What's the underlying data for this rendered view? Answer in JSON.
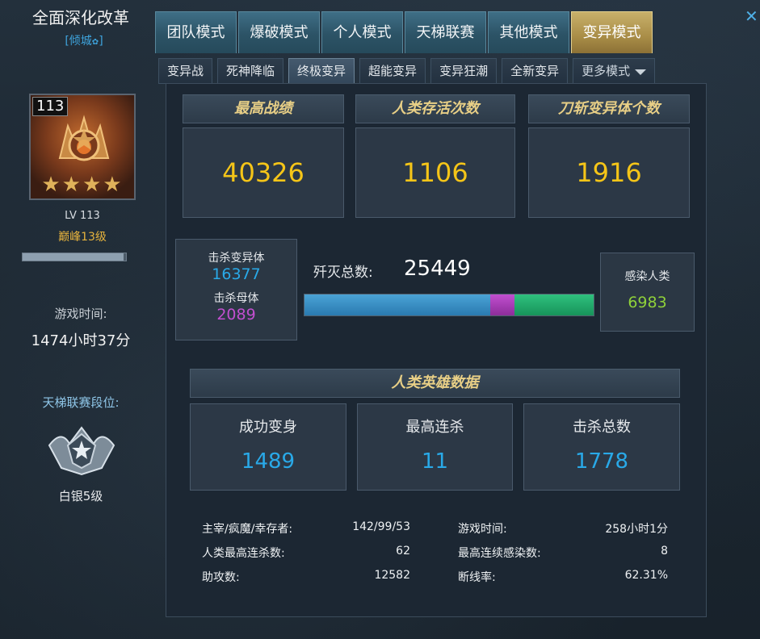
{
  "player": {
    "name": "全面深化改革",
    "clan": "[倾城",
    "clan_suffix": "]",
    "level_badge": "113",
    "level_text": "LV 113",
    "rank_title": "巅峰13级",
    "stars": "★★★★",
    "exp_fraction": 0.98,
    "game_time_label": "游戏时间:",
    "game_time_value": "1474小时37分",
    "ladder_label": "天梯联赛段位:",
    "ladder_rank": "白银5级"
  },
  "tabs": [
    {
      "label": "团队模式"
    },
    {
      "label": "爆破模式"
    },
    {
      "label": "个人模式"
    },
    {
      "label": "天梯联赛"
    },
    {
      "label": "其他模式"
    },
    {
      "label": "变异模式"
    }
  ],
  "active_tab": "变异模式",
  "subtabs": [
    {
      "label": "变异战"
    },
    {
      "label": "死神降临"
    },
    {
      "label": "终极变异"
    },
    {
      "label": "超能变异"
    },
    {
      "label": "变异狂潮"
    },
    {
      "label": "全新变异"
    },
    {
      "label": "更多模式"
    }
  ],
  "active_subtab": "终极变异",
  "top_stats": [
    {
      "label": "最高战绩",
      "value": "40326"
    },
    {
      "label": "人类存活次数",
      "value": "1106"
    },
    {
      "label": "刀斩变异体个数",
      "value": "1916"
    }
  ],
  "kills": {
    "mutant_label": "击杀变异体",
    "mutant_value": "16377",
    "mother_label": "击杀母体",
    "mother_value": "2089",
    "total_label": "歼灭总数:",
    "total_value": "25449",
    "infect_label": "感染人类",
    "infect_value": "6983"
  },
  "ratio_bar": {
    "mutant_fraction": 0.6435,
    "mother_fraction": 0.0821,
    "infect_fraction": 0.2744
  },
  "hero": {
    "title": "人类英雄数据",
    "items": [
      {
        "label": "成功变身",
        "value": "1489"
      },
      {
        "label": "最高连杀",
        "value": "11"
      },
      {
        "label": "击杀总数",
        "value": "1778"
      }
    ]
  },
  "details_left": [
    {
      "label": "主宰/疯魔/幸存者:",
      "value": "142/99/53"
    },
    {
      "label": "人类最高连杀数:",
      "value": "62"
    },
    {
      "label": "助攻数:",
      "value": "12582"
    }
  ],
  "details_right": [
    {
      "label": "游戏时间:",
      "value": "258小时1分"
    },
    {
      "label": "最高连续感染数:",
      "value": "8"
    },
    {
      "label": "断线率:",
      "value": "62.31%"
    }
  ],
  "colors": {
    "gold": "#f5c518",
    "header_gold": "#e8cf86",
    "blue": "#29a9e8",
    "purple": "#c14fcf",
    "green": "#8fd13a"
  },
  "icons": {
    "close": "close-icon",
    "caret": "chevron-down-icon",
    "ladder": "silver-rank-icon"
  }
}
